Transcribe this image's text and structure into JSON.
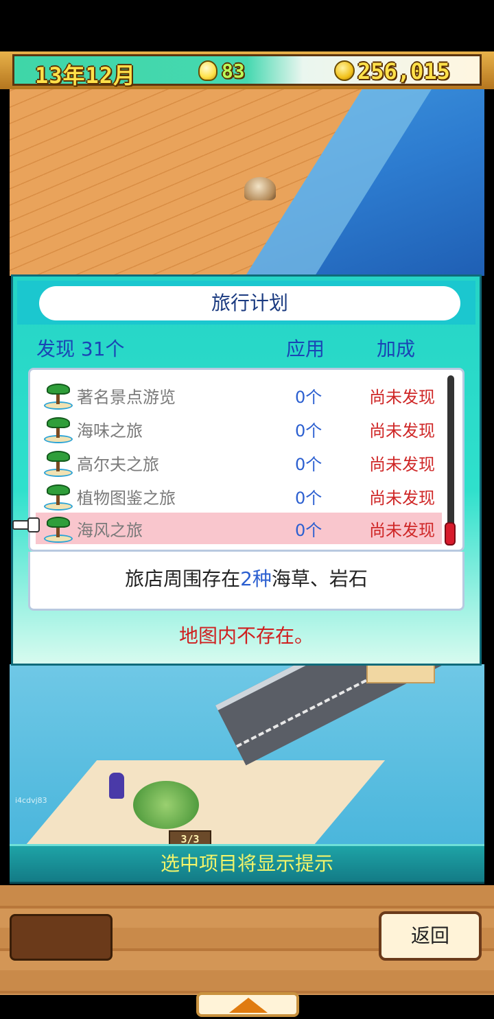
{
  "status_bar": {
    "date": "13年12月",
    "ideas": "83",
    "money": "256,015"
  },
  "dialog": {
    "title": "旅行计划",
    "discovered_label": "发现 31个",
    "apply_header": "应用",
    "bonus_header": "加成",
    "rows": [
      {
        "name": "著名景点游览",
        "count": "0个",
        "bonus": "尚未发现"
      },
      {
        "name": "海味之旅",
        "count": "0个",
        "bonus": "尚未发现"
      },
      {
        "name": "高尔夫之旅",
        "count": "0个",
        "bonus": "尚未发现"
      },
      {
        "name": "植物图鉴之旅",
        "count": "0个",
        "bonus": "尚未发现"
      },
      {
        "name": "海风之旅",
        "count": "0个",
        "bonus": "尚未发现"
      }
    ],
    "hint_prefix": "旅店周围存在",
    "hint_highlight": "2种",
    "hint_suffix": "海草、岩石",
    "status": "地图内不存在。"
  },
  "scene": {
    "room_badge": "3/3",
    "watermark": "i4cdvj83"
  },
  "tip_bar": "选中项目将显示提示",
  "footer": {
    "back_label": "返回"
  },
  "colors": {
    "accent": "#25d4c6",
    "highlight_blue": "#2b5fd0",
    "alert_red": "#cf1f1f"
  }
}
